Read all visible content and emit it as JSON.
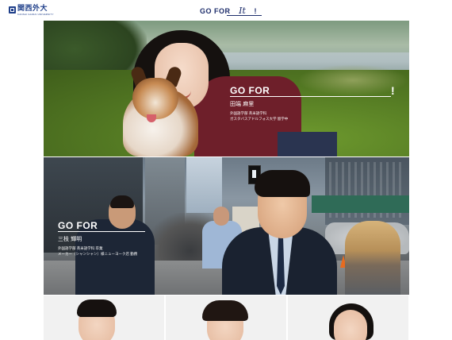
{
  "header": {
    "logo_text": "関西外大",
    "logo_subtext": "KANSAI GAIDAI UNIVERSITY",
    "brand_text": "GO FOR",
    "brand_signature": "It",
    "brand_exclaim": "!"
  },
  "hero_profiles": [
    {
      "gofor_label": "GO FOR",
      "exclaim": "!",
      "name": "田端 麻里",
      "description_lines": [
        "外国語学部 英米語学科",
        "ガスタバスアドルフォス大学 留学中"
      ]
    },
    {
      "gofor_label": "GO FOR",
      "name": "三枝 輝明",
      "description_lines": [
        "外国語学部 英米語学科 卒業",
        "メーカー（シャンシャン）様ニューヨーク店 勤務"
      ]
    }
  ],
  "bottom_cards": [
    {
      "name": "profile-card-1"
    },
    {
      "name": "profile-card-2"
    },
    {
      "name": "profile-card-3"
    }
  ]
}
